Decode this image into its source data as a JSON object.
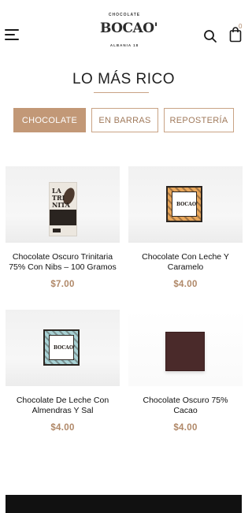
{
  "header": {
    "logo": {
      "top_text": "CHOCOLATE",
      "brand": "BOCAO'",
      "bottom_text": "ALBANIA 18"
    },
    "cart_count": "0",
    "icons": [
      "hamburger-menu-icon",
      "search-icon",
      "shopping-bag-icon"
    ]
  },
  "section": {
    "title": "LO MÁS RICO"
  },
  "tabs": [
    {
      "label": "CHOCOLATE",
      "active": true
    },
    {
      "label": "EN BARRAS",
      "active": false
    },
    {
      "label": "REPOSTERÍA",
      "active": false
    }
  ],
  "products": [
    {
      "name": "Chocolate Oscuro Trinitaria 75% Con Nibs – 100 Gramos",
      "price": "$7.00",
      "pack_text": "LA TRI NITA RIA"
    },
    {
      "name": "Chocolate Con Leche Y Caramelo",
      "price": "$4.00",
      "pack_text": "BOCAO'"
    },
    {
      "name": "Chocolate De Leche Con Almendras Y Sal",
      "price": "$4.00",
      "pack_text": "BOCAO'"
    },
    {
      "name": "Chocolate Oscuro 75% Cacao",
      "price": "$4.00"
    }
  ],
  "colors": {
    "accent": "#c29877",
    "price": "#b08868",
    "text": "#1a1a1a"
  }
}
